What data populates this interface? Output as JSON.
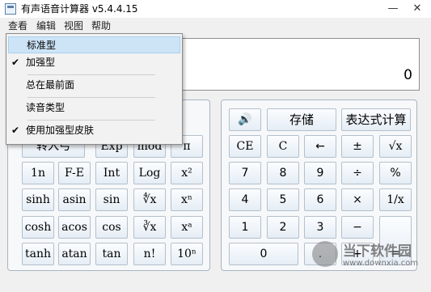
{
  "window": {
    "title": "有声语音计算器 v5.4.4.15",
    "minimize_symbol": "—",
    "close_symbol": "✕"
  },
  "menubar": [
    "查看",
    "编辑",
    "视图",
    "帮助"
  ],
  "view_menu": {
    "items": [
      {
        "label": "标准型",
        "checked": false,
        "highlighted": true
      },
      {
        "label": "加强型",
        "checked": true,
        "highlighted": false
      },
      {
        "label": "总在最前面",
        "checked": false,
        "highlighted": false
      },
      {
        "label": "读音类型",
        "checked": false,
        "highlighted": false
      },
      {
        "label": "使用加强型皮肤",
        "checked": true,
        "highlighted": false
      }
    ],
    "check_mark": "✔"
  },
  "display": {
    "value": "0"
  },
  "scientific_buttons": [
    [
      "",
      "",
      "",
      "",
      "π"
    ],
    [
      "1n",
      "F-E",
      "Int",
      "Log",
      "x²"
    ],
    [
      "sinh",
      "asin",
      "sin",
      "∜x",
      "xⁿ"
    ],
    [
      "cosh",
      "acos",
      "cos",
      "∛x",
      "xᵃ"
    ],
    [
      "tanh",
      "atan",
      "tan",
      "n!",
      "10ⁿ"
    ]
  ],
  "hidden_partial_labels": [
    "转入弓",
    "Exp",
    "mod"
  ],
  "standard_top": {
    "sound_label": "🔊",
    "store_label": "存储",
    "expr_label": "表达式计算"
  },
  "standard_buttons": [
    [
      "CE",
      "C",
      "←",
      "±",
      "√x"
    ],
    [
      "7",
      "8",
      "9",
      "÷",
      "%"
    ],
    [
      "4",
      "5",
      "6",
      "×",
      "1/x"
    ],
    [
      "1",
      "2",
      "3",
      "−",
      ""
    ],
    [
      "0",
      ".",
      "+",
      "="
    ]
  ],
  "watermark": {
    "text": "当下软件园",
    "url": "www.downxia.com"
  }
}
